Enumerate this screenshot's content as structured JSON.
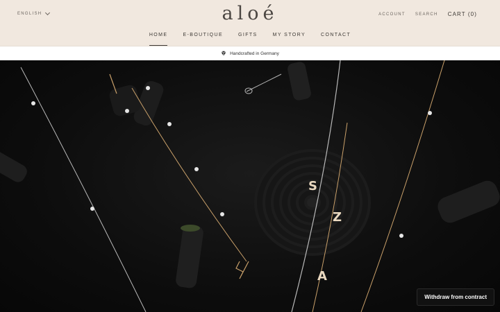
{
  "header": {
    "language": "ENGLISH",
    "logo": "aloé",
    "account": "ACCOUNT",
    "search": "SEARCH",
    "cart": "CART (0)"
  },
  "menu": {
    "items": [
      {
        "label": "HOME",
        "active": true
      },
      {
        "label": "E-BOUTIQUE",
        "active": false
      },
      {
        "label": "GIFTS",
        "active": false
      },
      {
        "label": "MY STORY",
        "active": false
      },
      {
        "label": "CONTACT",
        "active": false
      }
    ]
  },
  "announcement": {
    "icon": "diamond-icon",
    "text": "Handcrafted in Germany"
  },
  "hero": {
    "pendant_letters": [
      "S",
      "Z",
      "A"
    ]
  },
  "withdraw_label": "Withdraw from contract",
  "colors": {
    "header_bg": "#f1e8df",
    "announcement_bg": "#ffffff",
    "hero_bg": "#0c0c0c",
    "withdraw_bg": "#111111",
    "gold": "#c9a06a",
    "silver": "#b9b9b9"
  }
}
